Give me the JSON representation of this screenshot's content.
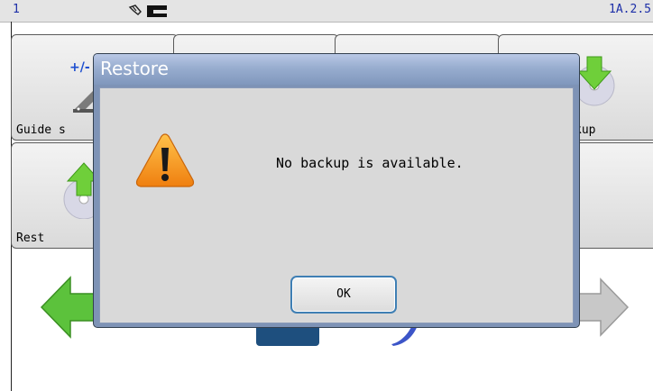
{
  "statusbar": {
    "left_text": "1",
    "right_text": "1A.2.5"
  },
  "tiles": {
    "guide_label": "Guide s",
    "backup_label": "kup",
    "restore_label": "Rest",
    "plusminus": "+/-"
  },
  "dialog": {
    "title": "Restore",
    "message": "No backup is available.",
    "ok_label": "OK"
  },
  "colors": {
    "title_bar": "#98adcf",
    "dialog_border": "#7e93b6",
    "arrow_green": "#5cc23c",
    "arrow_gray": "#c8c8c8",
    "warning_orange": "#f29a12"
  }
}
